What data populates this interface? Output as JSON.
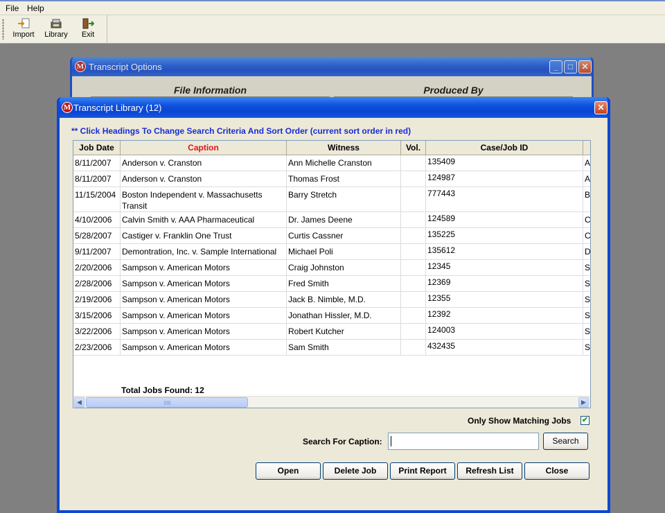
{
  "menu": {
    "file": "File",
    "help": "Help"
  },
  "toolbar": {
    "import_label": "Import",
    "library_label": "Library",
    "exit_label": "Exit"
  },
  "back_window": {
    "title": "Transcript Options",
    "file_info_header": "File Information",
    "produced_by_header": "Produced By"
  },
  "library": {
    "title": "Transcript Library (12)",
    "instruction": "** Click Headings To Change Search Criteria And Sort Order (current sort order in red)",
    "columns": {
      "job_date": "Job Date",
      "caption": "Caption",
      "witness": "Witness",
      "vol": "Vol.",
      "case_job_id": "Case/Job ID"
    },
    "sorted_color": "#e0141a",
    "rows": [
      {
        "date": "8/11/2007",
        "caption": "Anderson v. Cranston",
        "witness": "Ann Michelle Cranston",
        "vol": "",
        "case": "135409",
        "extra": "A"
      },
      {
        "date": "8/11/2007",
        "caption": "Anderson v. Cranston",
        "witness": "Thomas Frost",
        "vol": "",
        "case": "124987",
        "extra": "A"
      },
      {
        "date": "11/15/2004",
        "caption": "Boston Independent v. Massachusetts Transit",
        "witness": "Barry Stretch",
        "vol": "",
        "case": "777443",
        "extra": "B"
      },
      {
        "date": "4/10/2006",
        "caption": "Calvin Smith v. AAA Pharmaceutical",
        "witness": "Dr. James Deene",
        "vol": "",
        "case": "124589",
        "extra": "C"
      },
      {
        "date": "5/28/2007",
        "caption": "Castiger v. Franklin One Trust",
        "witness": "Curtis Cassner",
        "vol": "",
        "case": "135225",
        "extra": "C"
      },
      {
        "date": "9/11/2007",
        "caption": "Demontration, Inc. v. Sample International",
        "witness": "Michael Poli",
        "vol": "",
        "case": "135612",
        "extra": "D"
      },
      {
        "date": "2/20/2006",
        "caption": "Sampson v. American Motors",
        "witness": "Craig Johnston",
        "vol": "",
        "case": "12345",
        "extra": "S"
      },
      {
        "date": "2/28/2006",
        "caption": "Sampson v. American Motors",
        "witness": "Fred Smith",
        "vol": "",
        "case": "12369",
        "extra": "S"
      },
      {
        "date": "2/19/2006",
        "caption": "Sampson v. American Motors",
        "witness": "Jack B. Nimble, M.D.",
        "vol": "",
        "case": "12355",
        "extra": "S"
      },
      {
        "date": "3/15/2006",
        "caption": "Sampson v. American Motors",
        "witness": "Jonathan Hissler, M.D.",
        "vol": "",
        "case": "12392",
        "extra": "S"
      },
      {
        "date": "3/22/2006",
        "caption": "Sampson v. American Motors",
        "witness": "Robert Kutcher",
        "vol": "",
        "case": "124003",
        "extra": "S"
      },
      {
        "date": "2/23/2006",
        "caption": "Sampson v. American Motors",
        "witness": "Sam Smith",
        "vol": "",
        "case": "432435",
        "extra": "S"
      }
    ],
    "total_label": "Total Jobs Found: 12",
    "only_matching_label": "Only Show Matching Jobs",
    "only_matching_checked": true,
    "search_label": "Search For Caption:",
    "search_value": "",
    "search_button": "Search",
    "buttons": {
      "open": "Open",
      "delete": "Delete Job",
      "print": "Print Report",
      "refresh": "Refresh List",
      "close": "Close"
    }
  },
  "icons": {
    "app": "M",
    "close": "✕",
    "minimize": "_",
    "maximize": "□",
    "scroll_left": "◀",
    "scroll_right": "▶",
    "check": "✔"
  }
}
